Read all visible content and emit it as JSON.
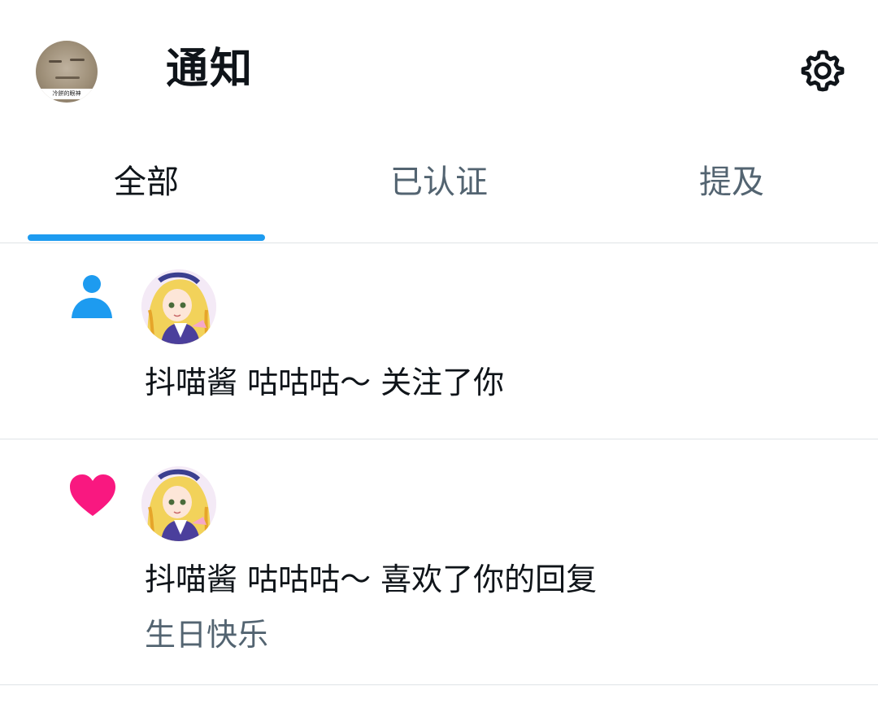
{
  "header": {
    "title": "通知",
    "avatar_caption": "冷餅的眼神",
    "settings_icon": "gear-icon"
  },
  "tabs": [
    {
      "label": "全部",
      "active": true
    },
    {
      "label": "已认证",
      "active": false
    },
    {
      "label": "提及",
      "active": false
    }
  ],
  "notifications": [
    {
      "type_icon": "person-icon",
      "text": "抖喵酱 咕咕咕～ 关注了你"
    },
    {
      "type_icon": "heart-icon",
      "text": "抖喵酱 咕咕咕～ 喜欢了你的回复",
      "quote": "生日快乐"
    }
  ],
  "colors": {
    "accent": "#1d9bf0",
    "like": "#f91880",
    "text_primary": "#0f1419",
    "text_secondary": "#536471",
    "divider": "#dfe3e6"
  }
}
